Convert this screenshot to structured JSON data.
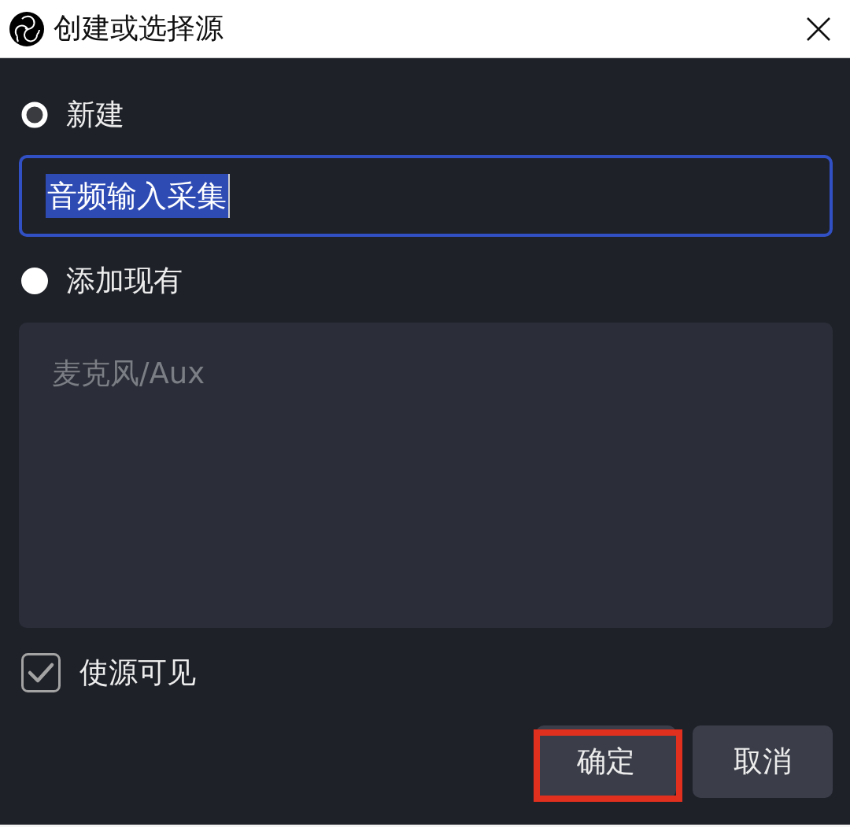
{
  "window": {
    "title": "创建或选择源"
  },
  "choices": [
    {
      "kind": "field",
      "label": "新建",
      "selected": true,
      "value": "音频输入采集",
      "focused": true,
      "text_selected": true
    },
    {
      "kind": "list",
      "label": "添加现有",
      "selected": false,
      "items": [
        "麦克风/Aux"
      ],
      "disabled": true
    }
  ],
  "make_visible": {
    "label": "使源可见",
    "checked": true
  },
  "buttons": [
    {
      "label": "确定",
      "highlighted": true
    },
    {
      "label": "取消",
      "highlighted": false
    }
  ]
}
